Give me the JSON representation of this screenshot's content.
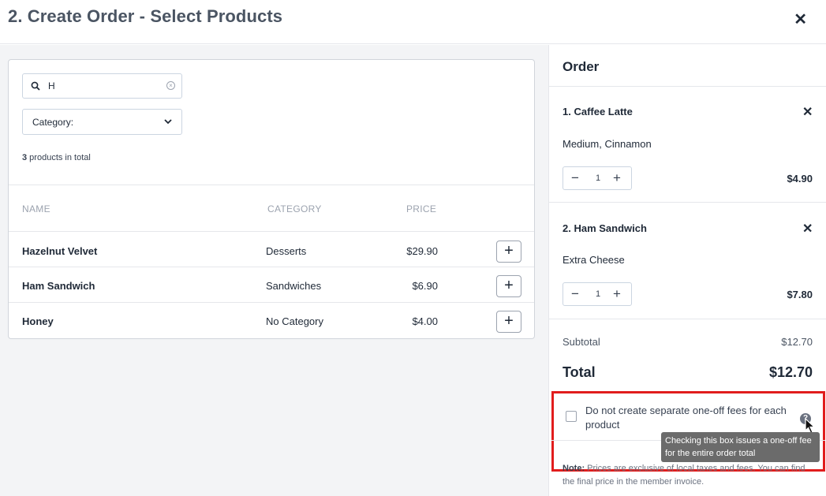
{
  "header": {
    "title": "2. Create Order - Select Products",
    "close": "✕"
  },
  "search": {
    "value": "H",
    "clear": "×"
  },
  "category": {
    "label": "Category:"
  },
  "product_count": {
    "number": "3",
    "text": " products in total"
  },
  "table": {
    "columns": {
      "name": "NAME",
      "category": "CATEGORY",
      "price": "PRICE"
    },
    "rows": [
      {
        "name": "Hazelnut Velvet",
        "category": "Desserts",
        "price": "$29.90"
      },
      {
        "name": "Ham Sandwich",
        "category": "Sandwiches",
        "price": "$6.90"
      },
      {
        "name": "Honey",
        "category": "No Category",
        "price": "$4.00"
      }
    ],
    "add_label": "+"
  },
  "order": {
    "title": "Order",
    "remove_label": "✕",
    "items": [
      {
        "name": "1. Caffee Latte",
        "options": "Medium, Cinnamon",
        "qty": "1",
        "price": "$4.90"
      },
      {
        "name": "2. Ham Sandwich",
        "options": "Extra Cheese",
        "qty": "1",
        "price": "$7.80"
      }
    ],
    "stepper": {
      "minus": "−",
      "plus": "+"
    },
    "subtotal_label": "Subtotal",
    "subtotal_value": "$12.70",
    "total_label": "Total",
    "total_value": "$12.70",
    "fee_checkbox_label": "Do not create separate one-off fees for each product",
    "help_icon": "?",
    "tooltip": "Checking this box issues a one-off fee for the entire order total",
    "note_bold": "Note:",
    "note_text": " Prices are exclusive of local taxes and fees. You can find the final price in the member invoice."
  },
  "colors": {
    "highlight": "#e11d1d",
    "tooltip_bg": "#6b6b6b"
  }
}
